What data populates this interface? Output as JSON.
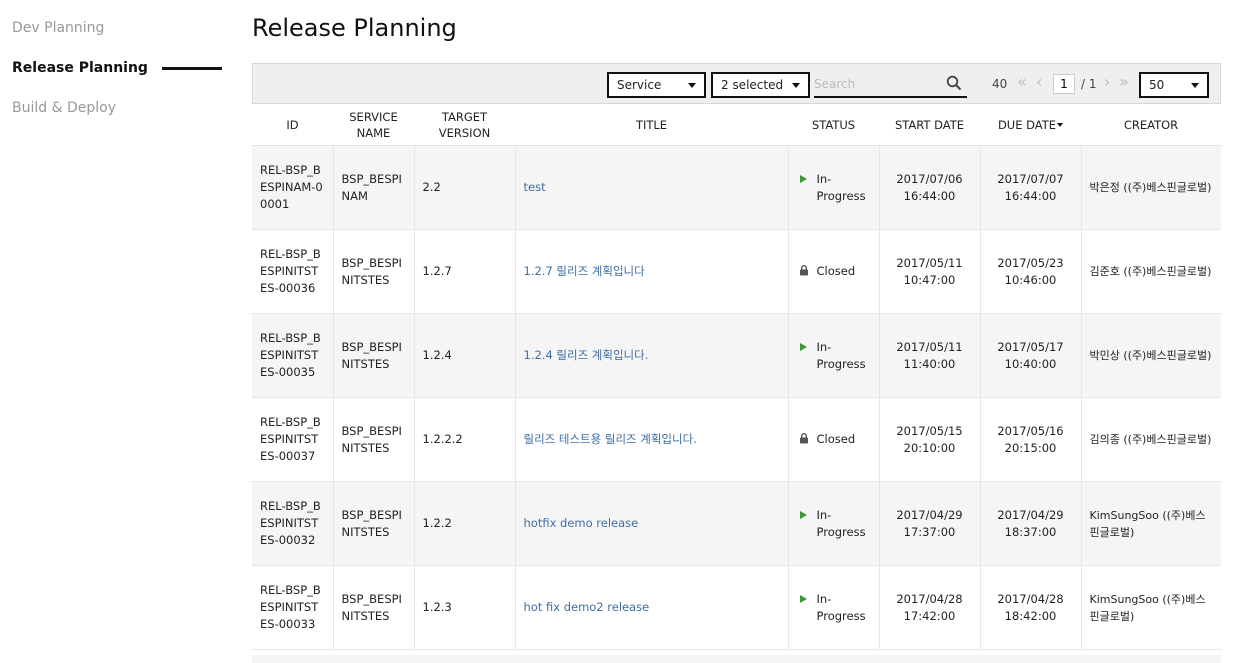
{
  "sidebar": {
    "items": [
      {
        "label": "Dev Planning"
      },
      {
        "label": "Release Planning"
      },
      {
        "label": "Build & Deploy"
      }
    ]
  },
  "page": {
    "title": "Release Planning"
  },
  "toolbar": {
    "service_select": "Service",
    "status_select": "2 selected",
    "search_placeholder": "Search",
    "total_count": "40",
    "current_page": "1",
    "page_total": "/ 1",
    "page_size": "50"
  },
  "table": {
    "headers": {
      "id": "ID",
      "service_name": "SERVICE NAME",
      "target_version": "TARGET VERSION",
      "title": "TITLE",
      "status": "STATUS",
      "start_date": "START DATE",
      "due_date": "DUE DATE",
      "creator": "CREATOR"
    },
    "rows": [
      {
        "id": "REL-BSP_BESPINAM-00001",
        "service": "BSP_BESPINAM",
        "version": "2.2",
        "title": "test",
        "status": "In-Progress",
        "start": "2017/07/06 16:44:00",
        "due": "2017/07/07 16:44:00",
        "creator": "박은정 ((주)베스핀글로벌)"
      },
      {
        "id": "REL-BSP_BESPINITSTES-00036",
        "service": "BSP_BESPINITSTES",
        "version": "1.2.7",
        "title": "1.2.7 릴리즈 계획입니다",
        "status": "Closed",
        "start": "2017/05/11 10:47:00",
        "due": "2017/05/23 10:46:00",
        "creator": "김준호 ((주)베스핀글로벌)"
      },
      {
        "id": "REL-BSP_BESPINITSTES-00035",
        "service": "BSP_BESPINITSTES",
        "version": "1.2.4",
        "title": "1.2.4 릴리즈 계획입니다.",
        "status": "In-Progress",
        "start": "2017/05/11 11:40:00",
        "due": "2017/05/17 10:40:00",
        "creator": "박민상 ((주)베스핀글로벌)"
      },
      {
        "id": "REL-BSP_BESPINITSTES-00037",
        "service": "BSP_BESPINITSTES",
        "version": "1.2.2.2",
        "title": "릴리즈 테스트용 릴리즈 계획입니다.",
        "status": "Closed",
        "start": "2017/05/15 20:10:00",
        "due": "2017/05/16 20:15:00",
        "creator": "김의종 ((주)베스핀글로벌)"
      },
      {
        "id": "REL-BSP_BESPINITSTES-00032",
        "service": "BSP_BESPINITSTES",
        "version": "1.2.2",
        "title": "hotfix demo release",
        "status": "In-Progress",
        "start": "2017/04/29 17:37:00",
        "due": "2017/04/29 18:37:00",
        "creator": "KimSungSoo ((주)베스핀글로벌)"
      },
      {
        "id": "REL-BSP_BESPINITSTES-00033",
        "service": "BSP_BESPINITSTES",
        "version": "1.2.3",
        "title": "hot fix demo2 release",
        "status": "In-Progress",
        "start": "2017/04/28 17:42:00",
        "due": "2017/04/28 18:42:00",
        "creator": "KimSungSoo ((주)베스핀글로벌)"
      }
    ]
  },
  "colors": {
    "link": "#3f6da5",
    "in_progress_icon": "#3a9a3a",
    "closed_icon": "#555555"
  },
  "icons": {
    "search": "search-icon",
    "first_page": "double-chevron-left-icon",
    "prev_page": "chevron-left-icon",
    "next_page": "chevron-right-icon",
    "last_page": "double-chevron-right-icon",
    "in_progress": "play-icon",
    "closed": "lock-icon",
    "sort": "sort-down-icon"
  }
}
